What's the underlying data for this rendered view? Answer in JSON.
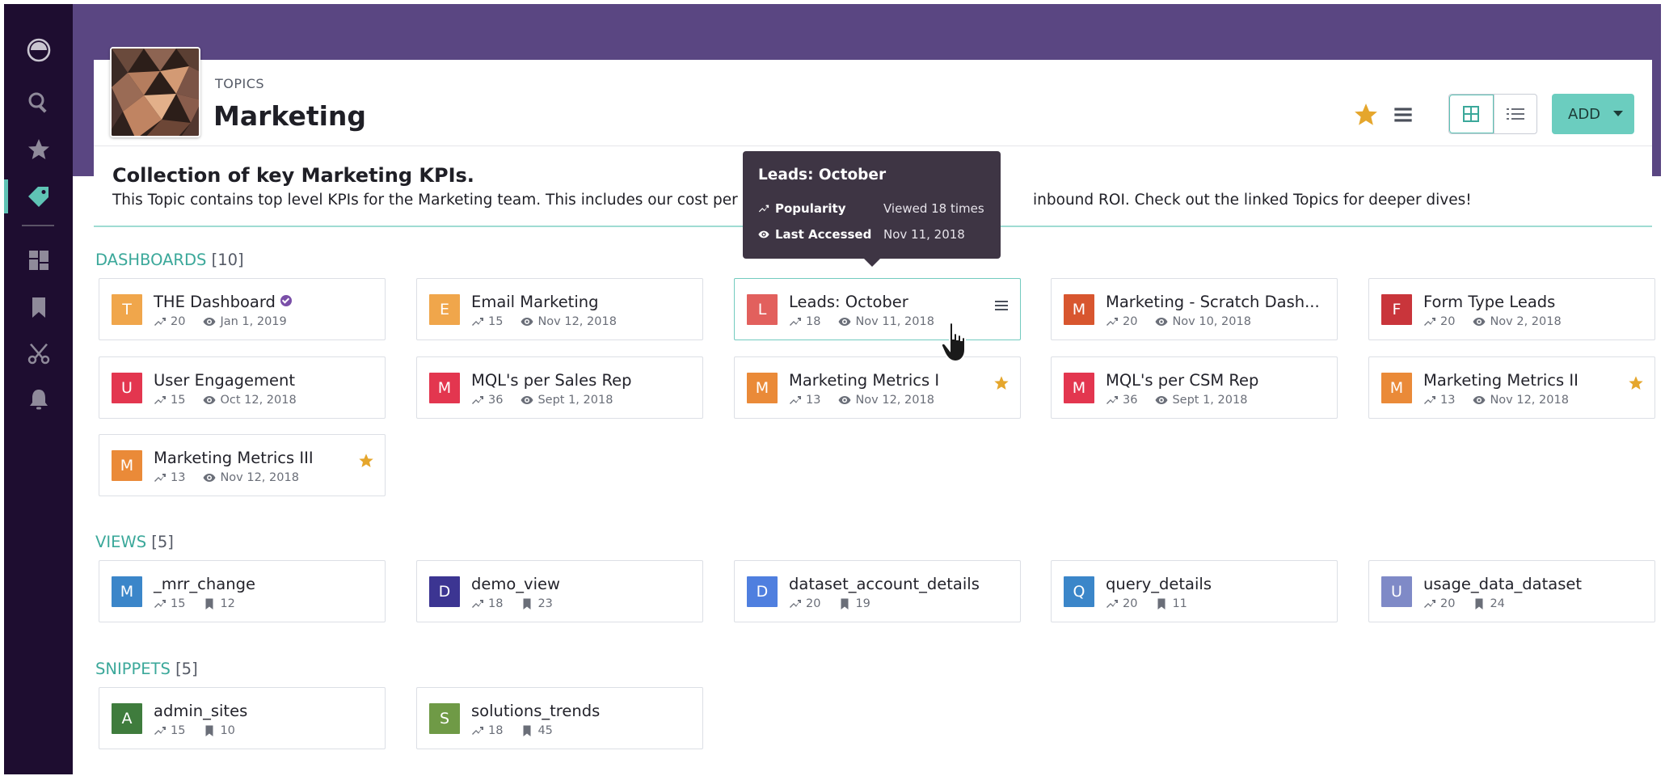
{
  "header": {
    "kicker": "TOPICS",
    "title": "Marketing",
    "add_label": "ADD"
  },
  "description": {
    "title": "Collection of key Marketing KPIs.",
    "text": "This Topic contains top level KPIs for the Marketing team. This includes our cost per lead",
    "text_tail": "inbound ROI. Check out the linked Topics for deeper dives!"
  },
  "tooltip": {
    "title": "Leads: October",
    "popularity_label": "Popularity",
    "popularity_value": "Viewed 18 times",
    "accessed_label": "Last Accessed",
    "accessed_value": "Nov 11, 2018"
  },
  "dashboards": {
    "label": "DASHBOARDS",
    "count": "[10]",
    "items": [
      {
        "initial": "T",
        "title": "THE Dashboard",
        "popularity": "20",
        "date": "Jan 1, 2019",
        "color": "#f0a64b"
      },
      {
        "initial": "E",
        "title": "Email Marketing",
        "popularity": "15",
        "date": "Nov 12, 2018",
        "color": "#f0a64b"
      },
      {
        "initial": "L",
        "title": "Leads: October",
        "popularity": "18",
        "date": "Nov 11, 2018",
        "color": "#e2605d"
      },
      {
        "initial": "M",
        "title": "Marketing - Scratch Dash...",
        "popularity": "20",
        "date": "Nov 10, 2018",
        "color": "#d8562f"
      },
      {
        "initial": "F",
        "title": "Form Type Leads",
        "popularity": "20",
        "date": "Nov 2, 2018",
        "color": "#c9353b"
      },
      {
        "initial": "U",
        "title": "User Engagement",
        "popularity": "15",
        "date": "Oct 12, 2018",
        "color": "#e3364f"
      },
      {
        "initial": "M",
        "title": "MQL's per Sales Rep",
        "popularity": "36",
        "date": "Sept 1, 2018",
        "color": "#e3364f"
      },
      {
        "initial": "M",
        "title": "Marketing Metrics I",
        "popularity": "13",
        "date": "Nov 12, 2018",
        "color": "#ea8a38"
      },
      {
        "initial": "M",
        "title": "MQL's per CSM Rep",
        "popularity": "36",
        "date": "Sept 1, 2018",
        "color": "#e3364f"
      },
      {
        "initial": "M",
        "title": "Marketing Metrics II",
        "popularity": "13",
        "date": "Nov 12, 2018",
        "color": "#ea8a38"
      },
      {
        "initial": "M",
        "title": "Marketing Metrics III",
        "popularity": "13",
        "date": "Nov 12, 2018",
        "color": "#ea8a38"
      }
    ]
  },
  "views": {
    "label": "VIEWS",
    "count": "[5]",
    "items": [
      {
        "initial": "M",
        "title": "_mrr_change",
        "popularity": "15",
        "saves": "12",
        "color": "#3b86c9"
      },
      {
        "initial": "D",
        "title": "demo_view",
        "popularity": "18",
        "saves": "23",
        "color": "#3c3592"
      },
      {
        "initial": "D",
        "title": "dataset_account_details",
        "popularity": "20",
        "saves": "19",
        "color": "#4f7fdf"
      },
      {
        "initial": "Q",
        "title": "query_details",
        "popularity": "20",
        "saves": "11",
        "color": "#3b86c9"
      },
      {
        "initial": "U",
        "title": "usage_data_dataset",
        "popularity": "20",
        "saves": "24",
        "color": "#7f8ac7"
      }
    ]
  },
  "snippets": {
    "label": "SNIPPETS",
    "count": "[5]",
    "items": [
      {
        "initial": "A",
        "title": "admin_sites",
        "popularity": "15",
        "saves": "10",
        "color": "#3f7c3d"
      },
      {
        "initial": "S",
        "title": "solutions_trends",
        "popularity": "18",
        "saves": "45",
        "color": "#6f9a46"
      }
    ]
  },
  "colors": {
    "nav_bg": "#1e0d30",
    "banner": "#5a4682",
    "accent": "#5fc3b5",
    "star": "#e5a62c"
  }
}
